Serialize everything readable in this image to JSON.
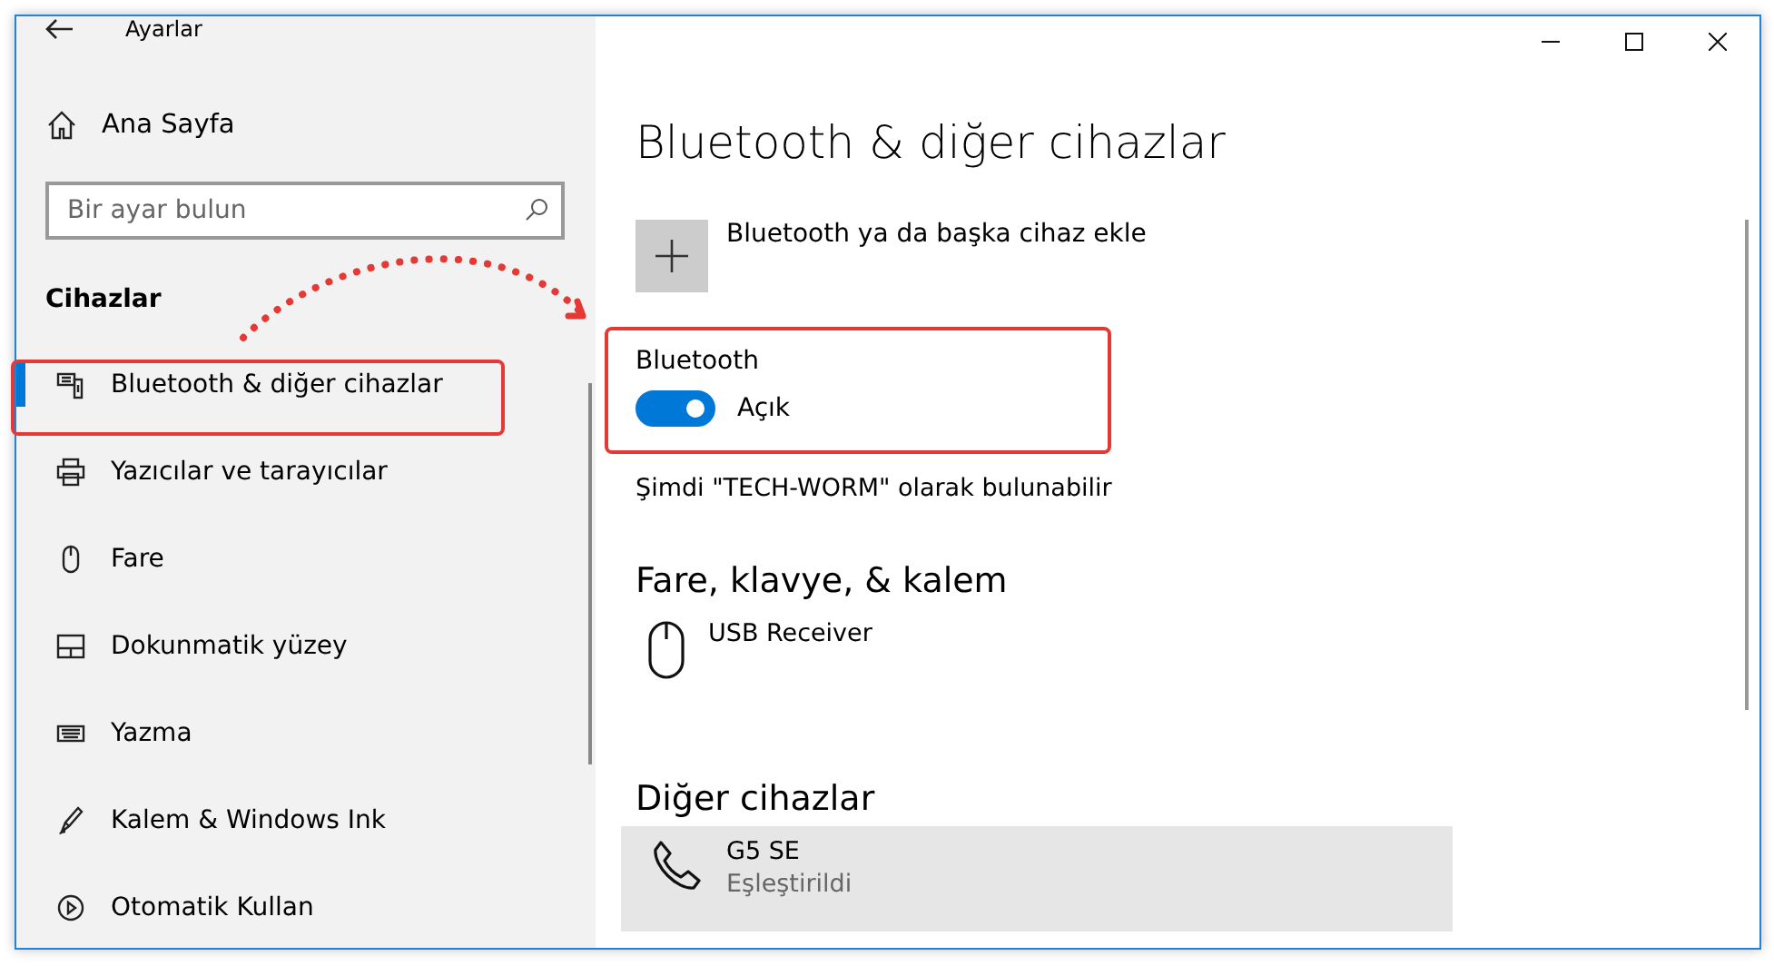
{
  "window": {
    "title": "Ayarlar"
  },
  "sidebar": {
    "home": "Ana Sayfa",
    "search": {
      "placeholder": "Bir ayar bulun"
    },
    "section": "Cihazlar",
    "items": [
      {
        "label": "Bluetooth & diğer cihazlar",
        "selected": true
      },
      {
        "label": "Yazıcılar ve tarayıcılar",
        "selected": false
      },
      {
        "label": "Fare",
        "selected": false
      },
      {
        "label": "Dokunmatik yüzey",
        "selected": false
      },
      {
        "label": "Yazma",
        "selected": false
      },
      {
        "label": "Kalem & Windows Ink",
        "selected": false
      },
      {
        "label": "Otomatik Kullan",
        "selected": false
      }
    ]
  },
  "main": {
    "heading": "Bluetooth & diğer cihazlar",
    "add_device": "Bluetooth ya da başka cihaz ekle",
    "bluetooth": {
      "label": "Bluetooth",
      "on": true,
      "state": "Açık"
    },
    "discoverable": "Şimdi \"TECH-WORM\" olarak bulunabilir",
    "sections": [
      {
        "title": "Fare, klavye, & kalem",
        "devices": [
          {
            "name": "USB Receiver",
            "kind": "mouse",
            "selected": false
          }
        ]
      },
      {
        "title": "Diğer cihazlar",
        "devices": [
          {
            "name": "G5 SE",
            "status": "Eşleştirildi",
            "kind": "phone",
            "selected": true
          }
        ]
      }
    ]
  }
}
